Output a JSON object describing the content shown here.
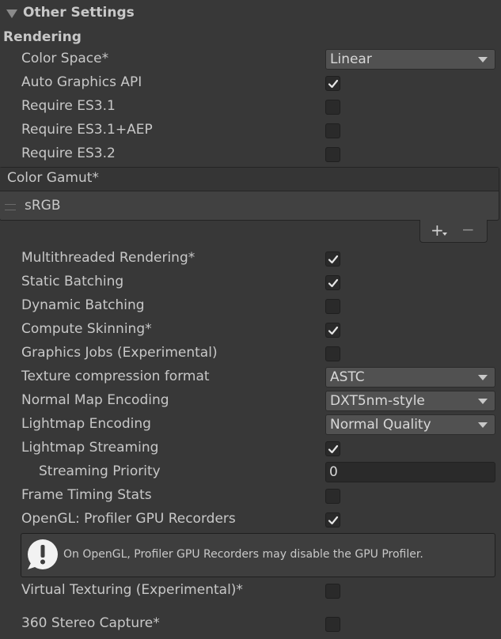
{
  "section": {
    "title": "Other Settings"
  },
  "group": {
    "title": "Rendering"
  },
  "rows_top": [
    {
      "label": "Color Space*",
      "control": "dropdown",
      "value": "Linear"
    },
    {
      "label": "Auto Graphics API",
      "control": "checkbox",
      "checked": true
    },
    {
      "label": "Require ES3.1",
      "control": "checkbox",
      "checked": false
    },
    {
      "label": "Require ES3.1+AEP",
      "control": "checkbox",
      "checked": false
    },
    {
      "label": "Require ES3.2",
      "control": "checkbox",
      "checked": false
    }
  ],
  "color_gamut": {
    "header": "Color Gamut*",
    "items": [
      "sRGB"
    ],
    "add_label": "+",
    "remove_label": "−"
  },
  "rows_bottom": [
    {
      "label": "Multithreaded Rendering*",
      "control": "checkbox",
      "checked": true
    },
    {
      "label": "Static Batching",
      "control": "checkbox",
      "checked": true
    },
    {
      "label": "Dynamic Batching",
      "control": "checkbox",
      "checked": false
    },
    {
      "label": "Compute Skinning*",
      "control": "checkbox",
      "checked": true
    },
    {
      "label": "Graphics Jobs (Experimental)",
      "control": "checkbox",
      "checked": false
    },
    {
      "label": "Texture compression format",
      "control": "dropdown",
      "value": "ASTC"
    },
    {
      "label": "Normal Map Encoding",
      "control": "dropdown",
      "value": "DXT5nm-style"
    },
    {
      "label": "Lightmap Encoding",
      "control": "dropdown",
      "value": "Normal Quality"
    },
    {
      "label": "Lightmap Streaming",
      "control": "checkbox",
      "checked": true
    },
    {
      "label": "Streaming Priority",
      "control": "textfield",
      "value": "0",
      "indent": true
    },
    {
      "label": "Frame Timing Stats",
      "control": "checkbox",
      "checked": false
    },
    {
      "label": "OpenGL: Profiler GPU Recorders",
      "control": "checkbox",
      "checked": true
    }
  ],
  "help": {
    "icon": "warning-icon",
    "text": "On OpenGL, Profiler GPU Recorders may disable the GPU Profiler."
  },
  "rows_after_help": [
    {
      "label": "Virtual Texturing (Experimental)*",
      "control": "checkbox",
      "checked": false
    },
    {
      "label": "360 Stereo Capture*",
      "control": "checkbox",
      "checked": false
    }
  ],
  "colors": {
    "background": "#383838",
    "text": "#c8c8c8",
    "field": "#2a2a2a",
    "dropdown": "#515151"
  }
}
